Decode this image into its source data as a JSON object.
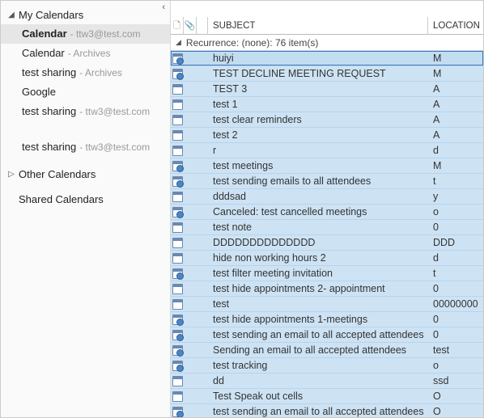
{
  "nav": {
    "sections": [
      {
        "label": "My Calendars",
        "expanded": true,
        "caretGlyph": "◢"
      },
      {
        "label": "Other Calendars",
        "expanded": false,
        "caretGlyph": "▷"
      },
      {
        "label": "Shared Calendars",
        "expanded": false,
        "caretGlyph": ""
      }
    ],
    "myCalendars": [
      {
        "name": "Calendar",
        "suffix": "- ttw3@test.com",
        "selected": true
      },
      {
        "name": "Calendar",
        "suffix": "- Archives"
      },
      {
        "name": "test sharing",
        "suffix": "- Archives"
      },
      {
        "name": "Google",
        "suffix": ""
      },
      {
        "name": "test sharing",
        "suffix": "- ttw3@test.com",
        "gapAfter": true
      },
      {
        "name": "test sharing",
        "suffix": "- ttw3@test.com"
      }
    ]
  },
  "columns": {
    "iconGlyph": "🗋",
    "attachGlyph": "📎",
    "subject": "SUBJECT",
    "location": "LOCATION"
  },
  "group": {
    "caretGlyph": "◢",
    "label": "Recurrence: (none): 76 item(s)"
  },
  "rows": [
    {
      "kind": "meeting",
      "subject": "huiyi",
      "location": "M",
      "cursor": true
    },
    {
      "kind": "meeting",
      "subject": "TEST DECLINE MEETING REQUEST",
      "location": "M"
    },
    {
      "kind": "appt",
      "subject": "TEST 3",
      "location": "A"
    },
    {
      "kind": "appt",
      "subject": "test 1",
      "location": "A"
    },
    {
      "kind": "appt",
      "subject": "test clear reminders",
      "location": "A"
    },
    {
      "kind": "appt",
      "subject": "test 2",
      "location": "A"
    },
    {
      "kind": "appt",
      "subject": "r",
      "location": "d"
    },
    {
      "kind": "meeting",
      "subject": "test meetings",
      "location": "M"
    },
    {
      "kind": "meeting",
      "subject": "test sending emails to all attendees",
      "location": "t"
    },
    {
      "kind": "appt",
      "subject": "dddsad",
      "location": "y"
    },
    {
      "kind": "meeting",
      "subject": "Canceled: test cancelled meetings",
      "location": "o"
    },
    {
      "kind": "appt",
      "subject": "test note",
      "location": "0"
    },
    {
      "kind": "appt",
      "subject": "DDDDDDDDDDDDDD",
      "location": "DDD"
    },
    {
      "kind": "appt",
      "subject": "hide non working hours 2",
      "location": "d"
    },
    {
      "kind": "meeting",
      "subject": "test filter meeting invitation",
      "location": "t"
    },
    {
      "kind": "appt",
      "subject": "test hide appointments 2- appointment",
      "location": "0"
    },
    {
      "kind": "appt",
      "subject": "test",
      "location": "00000000"
    },
    {
      "kind": "meeting",
      "subject": "test hide appointments 1-meetings",
      "location": "0"
    },
    {
      "kind": "meeting",
      "subject": "test sending an email to all accepted attendees",
      "location": "0"
    },
    {
      "kind": "meeting",
      "subject": "Sending an email to all accepted attendees",
      "location": "test"
    },
    {
      "kind": "meeting",
      "subject": "test tracking",
      "location": "o"
    },
    {
      "kind": "appt",
      "subject": "dd",
      "location": "ssd"
    },
    {
      "kind": "appt",
      "subject": "Test Speak out cells",
      "location": "O"
    },
    {
      "kind": "meeting",
      "subject": "test sending an email to all accepted attendees",
      "location": "O"
    }
  ]
}
